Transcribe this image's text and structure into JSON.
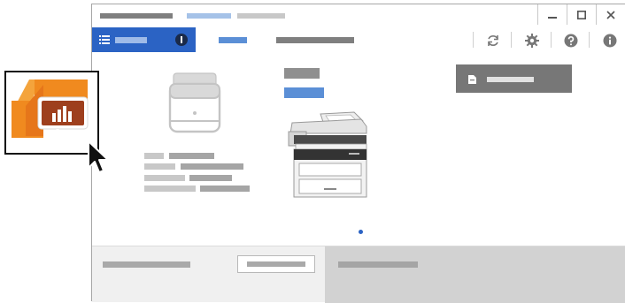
{
  "window": {
    "title_text": "",
    "tabs": [
      "",
      ""
    ]
  },
  "window_controls": {
    "minimize_icon": "minimize-icon",
    "maximize_icon": "maximize-icon",
    "close_icon": "close-icon"
  },
  "nav": {
    "menu_icon": "list-icon",
    "menu_label": "",
    "badge_icon": "info-badge-icon",
    "tabs": [
      {
        "label": "",
        "active": true
      },
      {
        "label": "",
        "active": false
      }
    ]
  },
  "toolbar": {
    "icons": [
      "refresh-icon",
      "gear-icon",
      "help-icon",
      "info-icon"
    ]
  },
  "main": {
    "printer_icon": "printer-outline-icon",
    "printer_name": "",
    "printer_status_link": "",
    "printer_photo": "multifunction-printer-image",
    "secondary_button_icon": "document-icon",
    "secondary_button_label": "",
    "info_rows": [
      {
        "label": "",
        "value": ""
      },
      {
        "label": "",
        "value": ""
      },
      {
        "label": "",
        "value": ""
      },
      {
        "label": "",
        "value": ""
      }
    ],
    "pager_dot": "page-indicator-dot"
  },
  "footer": {
    "left_text": "",
    "button_label": "",
    "right_text": ""
  },
  "app_tile": {
    "icon": "presentation-chart-app-icon",
    "cursor": "mouse-pointer-icon"
  },
  "colors": {
    "accent_blue": "#2b63c4",
    "link_blue": "#5b8fd6",
    "app_orange": "#f28a1e",
    "app_brown": "#9e3f1d"
  }
}
